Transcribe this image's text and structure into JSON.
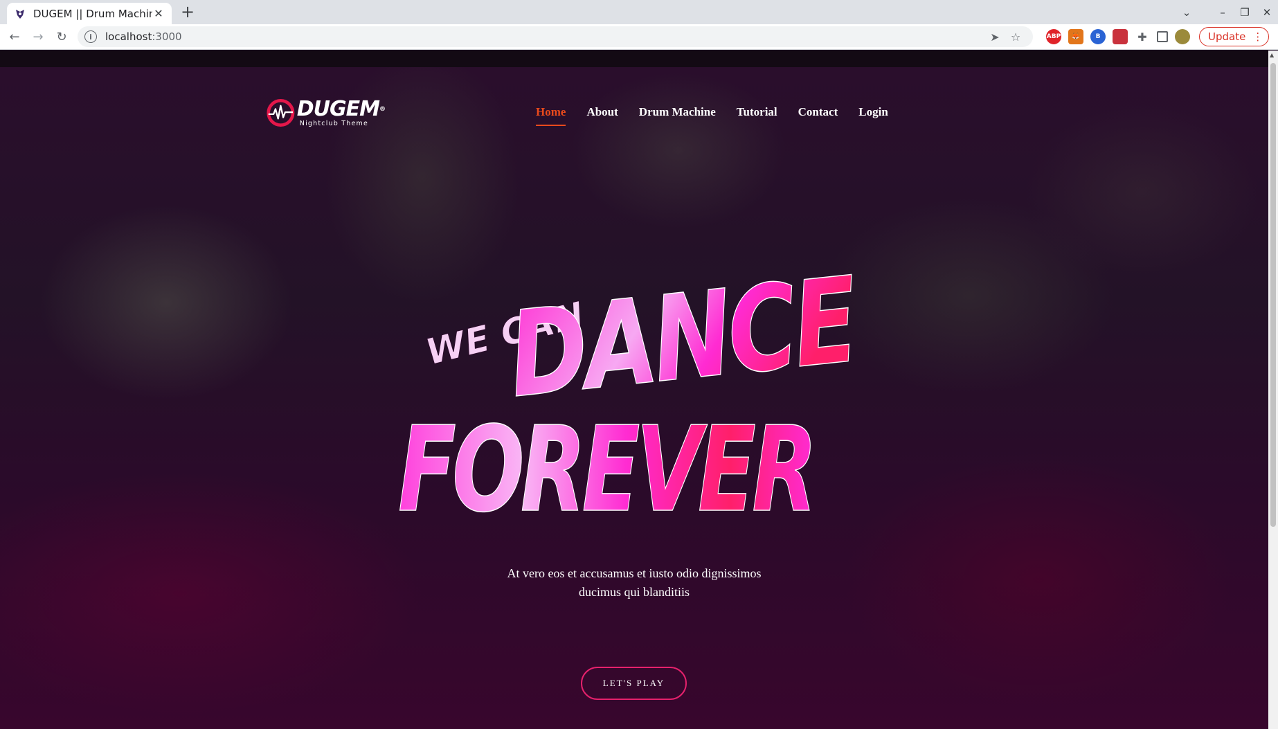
{
  "browser": {
    "tab_title": "DUGEM || Drum Machine",
    "new_tab_label": "+",
    "url_host": "localhost",
    "url_port": ":3000",
    "update_label": "Update",
    "extensions": [
      {
        "name": "adblock-icon",
        "label": "ABP",
        "color": "#e0242a"
      },
      {
        "name": "metamask-icon",
        "label": "",
        "color": "#e2761b"
      },
      {
        "name": "b-extension-icon",
        "label": "B",
        "color": "#2a63d4"
      },
      {
        "name": "red-extension-icon",
        "label": "",
        "color": "#c9323d"
      }
    ]
  },
  "site": {
    "logo": {
      "word": "DUGEM",
      "reg": "®",
      "tagline": "Nightclub Theme"
    },
    "nav": [
      {
        "label": "Home",
        "active": true
      },
      {
        "label": "About",
        "active": false
      },
      {
        "label": "Drum Machine",
        "active": false
      },
      {
        "label": "Tutorial",
        "active": false
      },
      {
        "label": "Contact",
        "active": false
      },
      {
        "label": "Login",
        "active": false
      }
    ],
    "hero": {
      "line_small": "WE CAN",
      "line_big_1": "DANCE",
      "line_big_2": "FOREVER",
      "subtitle": "At vero eos et accusamus et iusto odio dignissimos ducimus qui blanditiis",
      "cta_label": "LET'S PLAY"
    },
    "colors": {
      "accent": "#e94a1c",
      "button_border": "#e5216c",
      "title_pink": "#ff2bd2",
      "title_red": "#ff1f6a"
    }
  }
}
